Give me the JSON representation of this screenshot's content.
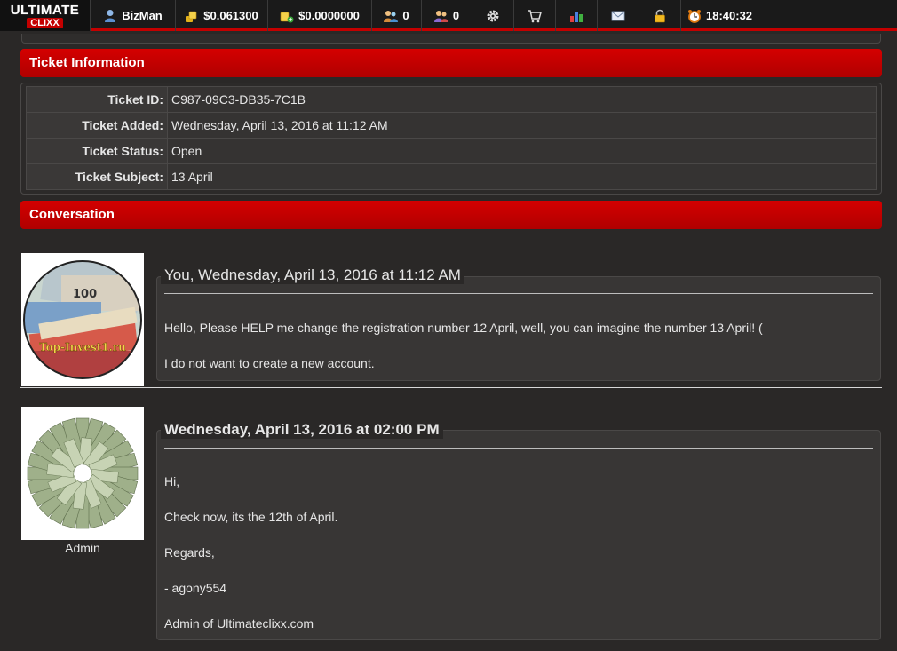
{
  "topbar": {
    "logo_top": "ULTIMATE",
    "logo_bottom": "CLIXX",
    "username": "BizMan",
    "balance_main": "$0.061300",
    "balance_purchase": "$0.0000000",
    "referrals_direct": "0",
    "referrals_rented": "0",
    "clock": "18:40:32",
    "icons": [
      "user-icon",
      "coins-icon",
      "coins-plus-icon",
      "referrals-icon",
      "rented-referrals-icon",
      "gear-icon",
      "cart-icon",
      "stats-icon",
      "mail-icon",
      "lock-icon",
      "alarm-clock-icon"
    ]
  },
  "ticket_info": {
    "heading": "Ticket Information",
    "rows": [
      {
        "label": "Ticket ID:",
        "value": "C987-09C3-DB35-7C1B"
      },
      {
        "label": "Ticket Added:",
        "value": "Wednesday, April 13, 2016 at 11:12 AM"
      },
      {
        "label": "Ticket Status:",
        "value": "Open"
      },
      {
        "label": "Ticket Subject:",
        "value": "13 April"
      }
    ]
  },
  "conversation": {
    "heading": "Conversation",
    "messages": [
      {
        "title": "You, Wednesday, April 13, 2016 at 11:12 AM",
        "avatar_caption": "",
        "avatar_text": "Top-Invest1.ru",
        "paragraphs": [
          "Hello, Please HELP me change the registration number 12 April, well, you can imagine the number 13 April! (",
          "I do not want to create a new account."
        ]
      },
      {
        "title": "Wednesday, April 13, 2016 at 02:00 PM",
        "avatar_caption": "Admin",
        "paragraphs": [
          "Hi,",
          "Check now, its the 12th of April.",
          "Regards,",
          "- agony554",
          "Admin of Ultimateclixx.com"
        ]
      }
    ]
  },
  "colors": {
    "accent": "#c40000",
    "background": "#2a2827",
    "panel": "#383635"
  }
}
